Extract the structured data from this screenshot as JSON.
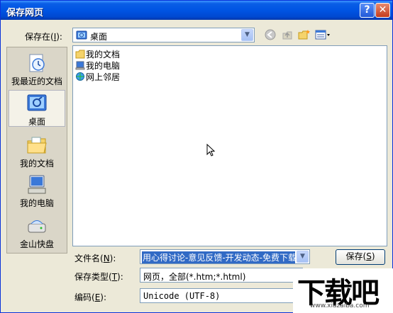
{
  "window": {
    "title": "保存网页",
    "help_glyph": "?",
    "close_glyph": "✕"
  },
  "save_in": {
    "label_pre": "保存在(",
    "label_key": "I",
    "label_post": "):",
    "value": "桌面"
  },
  "places": [
    {
      "label": "我最近的文档",
      "icon": "recent-documents-icon"
    },
    {
      "label": "桌面",
      "icon": "desktop-icon",
      "selected": true
    },
    {
      "label": "我的文档",
      "icon": "my-documents-icon"
    },
    {
      "label": "我的电脑",
      "icon": "my-computer-icon"
    },
    {
      "label": "金山快盘",
      "icon": "kuaipan-drive-icon"
    }
  ],
  "files": [
    {
      "name": "我的文档",
      "icon": "folder-icon"
    },
    {
      "name": "我的电脑",
      "icon": "computer-icon"
    },
    {
      "name": "网上邻居",
      "icon": "network-icon"
    }
  ],
  "filename": {
    "label_pre": "文件名(",
    "label_key": "N",
    "label_post": "):",
    "value": "用心得讨论-意见反馈-开发动态-免费下载"
  },
  "filetype": {
    "label_pre": "保存类型(",
    "label_key": "T",
    "label_post": "):",
    "value": "网页，全部(*.htm;*.html)"
  },
  "encoding": {
    "label_pre": "编码(",
    "label_key": "E",
    "label_post": "):",
    "value": "Unicode (UTF-8)"
  },
  "buttons": {
    "save_pre": "保存(",
    "save_key": "S",
    "save_post": ")"
  },
  "watermark": {
    "big": "下载吧",
    "small": "www.xiazaiba.com"
  }
}
